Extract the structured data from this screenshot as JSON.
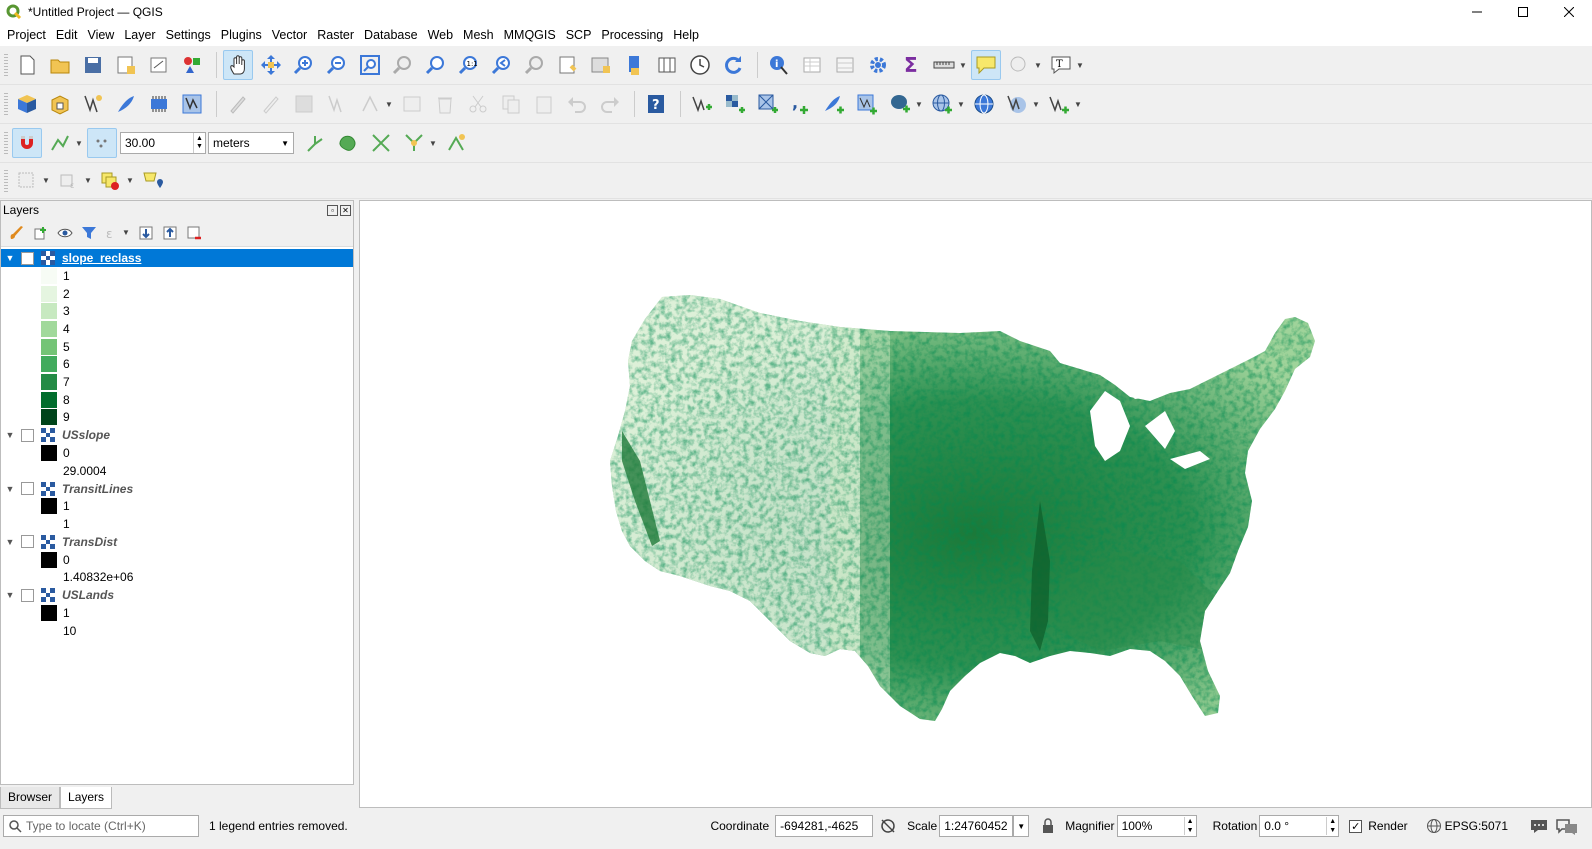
{
  "window": {
    "title": "*Untitled Project — QGIS"
  },
  "menu": [
    "Project",
    "Edit",
    "View",
    "Layer",
    "Settings",
    "Plugins",
    "Vector",
    "Raster",
    "Database",
    "Web",
    "Mesh",
    "MMQGIS",
    "SCP",
    "Processing",
    "Help"
  ],
  "snapping": {
    "tolerance": "30.00",
    "units": "meters"
  },
  "layers_panel": {
    "title": "Layers",
    "layers": [
      {
        "name": "slope_reclass",
        "checked": true,
        "selected": true,
        "legend": [
          {
            "label": "1",
            "color": "#f7fcf5"
          },
          {
            "label": "2",
            "color": "#e5f5e0"
          },
          {
            "label": "3",
            "color": "#c7e9c0"
          },
          {
            "label": "4",
            "color": "#a1d99b"
          },
          {
            "label": "5",
            "color": "#74c476"
          },
          {
            "label": "6",
            "color": "#41ab5d"
          },
          {
            "label": "7",
            "color": "#238b45"
          },
          {
            "label": "8",
            "color": "#006d2c"
          },
          {
            "label": "9",
            "color": "#00441b"
          }
        ]
      },
      {
        "name": "USslope",
        "checked": false,
        "legend": [
          {
            "label": "0",
            "color": "#000000"
          },
          {
            "label": "29.0004",
            "color": ""
          }
        ]
      },
      {
        "name": "TransitLines",
        "checked": false,
        "legend": [
          {
            "label": "1",
            "color": "#000000"
          },
          {
            "label": "1",
            "color": ""
          }
        ]
      },
      {
        "name": "TransDist",
        "checked": false,
        "legend": [
          {
            "label": "0",
            "color": "#000000"
          },
          {
            "label": "1.40832e+06",
            "color": ""
          }
        ]
      },
      {
        "name": "USLands",
        "checked": false,
        "legend": [
          {
            "label": "1",
            "color": "#000000"
          },
          {
            "label": "10",
            "color": ""
          }
        ]
      }
    ]
  },
  "panel_tabs": [
    "Browser",
    "Layers"
  ],
  "status": {
    "locate_placeholder": "Type to locate (Ctrl+K)",
    "message": "1 legend entries removed.",
    "coordinate_label": "Coordinate",
    "coordinate": "-694281,-4625",
    "scale_label": "Scale",
    "scale": "1:24760452",
    "magnifier_label": "Magnifier",
    "magnifier": "100%",
    "rotation_label": "Rotation",
    "rotation": "0.0 °",
    "render_label": "Render",
    "crs": "EPSG:5071"
  },
  "colors": {
    "selection": "#0078d7",
    "map_light": "#f7fcf5",
    "map_dark": "#00441b"
  }
}
